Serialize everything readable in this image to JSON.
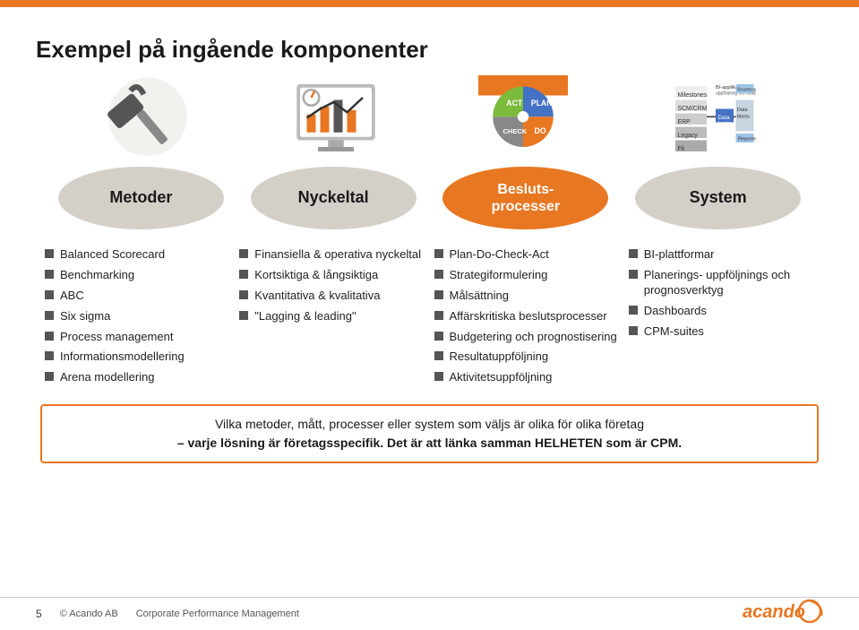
{
  "page": {
    "title": "Exempel på ingående komponenter",
    "topBarColor": "#e87722"
  },
  "categories": [
    {
      "id": "metoder",
      "label": "Metoder",
      "bg": "#d4d0c8"
    },
    {
      "id": "nyckeltal",
      "label": "Nyckeltal",
      "bg": "#d4d0c8"
    },
    {
      "id": "beslutsprocesser",
      "label": "Beslutsprocesser",
      "bg": "#e87722"
    },
    {
      "id": "system",
      "label": "System",
      "bg": "#d4d0c8"
    }
  ],
  "columns": [
    {
      "id": "metoder",
      "bullets": [
        "Balanced Scorecard",
        "Benchmarking",
        "ABC",
        "Six sigma",
        "Process management",
        "Informationsmodellering",
        "Arena modellering"
      ]
    },
    {
      "id": "nyckeltal",
      "bullets": [
        "Finansiella & operativa nyckeltal",
        "Kortsiktiga & långsiktiga",
        "Kvantitativa & kvalitativa",
        "\"Lagging & leading\""
      ]
    },
    {
      "id": "beslutsprocesser",
      "bullets": [
        "Plan-Do-Check-Act",
        "Strategiformulering",
        "Målsättning",
        "Affärskritiska beslutsprocesser",
        "Budgetering och prognostisering",
        "Resultatuppföljning",
        "Aktivitetsuppföljning"
      ]
    },
    {
      "id": "system",
      "bullets": [
        "BI-plattformar",
        "Planerings- uppföljnings och prognosverktyg",
        "Dashboards",
        "CPM-suites"
      ]
    }
  ],
  "bottomBox": {
    "line1": "Vilka metoder, mått, processer eller system som väljs är olika för olika företag",
    "line2": "– varje lösning är företagsspecifik. Det är att länka samman HELHETEN som är CPM."
  },
  "footer": {
    "pageNumber": "5",
    "company": "© Acando AB",
    "subtitle": "Corporate Performance Management"
  },
  "logo": {
    "text": "acando"
  }
}
